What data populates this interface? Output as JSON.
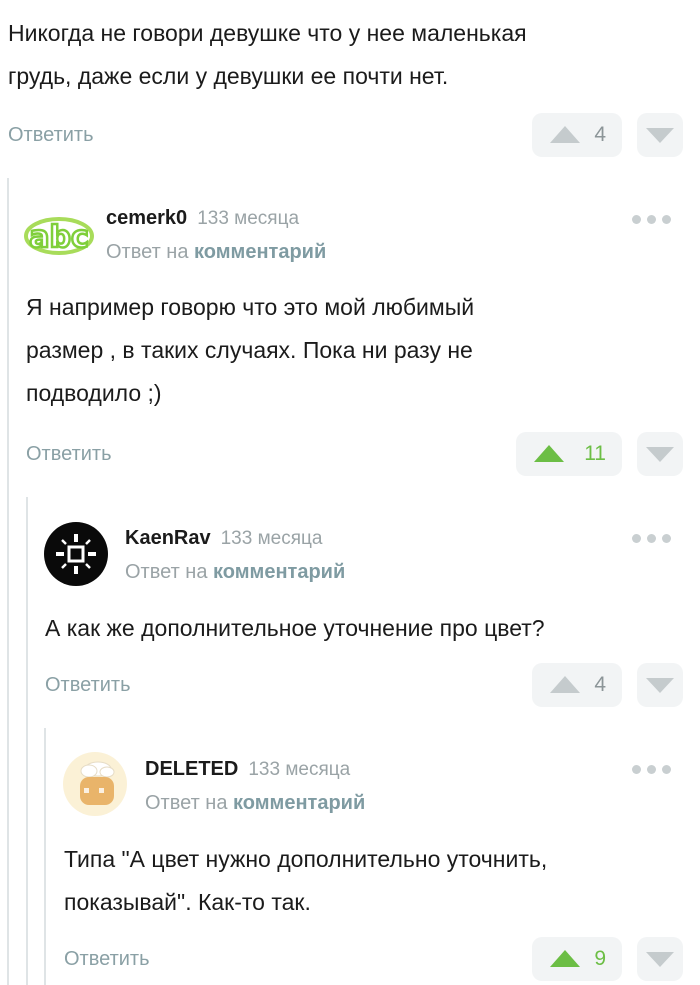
{
  "comments": [
    {
      "text_lines": [
        "Никогда не говори девушке что у нее маленькая",
        "грудь, даже если у девушки ее почти нет."
      ],
      "reply_label": "Ответить",
      "votes": "4",
      "votes_positive": false
    },
    {
      "author": "cemerk0",
      "time": "133 месяца",
      "reply_prefix": "Ответ на",
      "reply_link": "комментарий",
      "avatar": "abc-logo-icon",
      "text_lines": [
        "Я например говорю что это мой любимый",
        "размер , в таких случаях. Пока ни разу не",
        "подводило ;)"
      ],
      "reply_label": "Ответить",
      "votes": "11",
      "votes_positive": true
    },
    {
      "author": "KaenRav",
      "time": "133 месяца",
      "reply_prefix": "Ответ на",
      "reply_link": "комментарий",
      "avatar": "sun-symbol-icon",
      "text_lines": [
        "А как же дополнительное уточнение про цвет?"
      ],
      "reply_label": "Ответить",
      "votes": "4",
      "votes_positive": false
    },
    {
      "author": "DELETED",
      "time": "133 месяца",
      "reply_prefix": "Ответ на",
      "reply_link": "комментарий",
      "avatar": "toast-chef-icon",
      "text_lines": [
        "Типа \"А цвет нужно дополнительно уточнить,",
        "показывай\". Как-то так."
      ],
      "reply_label": "Ответить",
      "votes": "9",
      "votes_positive": true
    }
  ],
  "colors": {
    "upvote_positive": "#6cbe45",
    "reply_link": "#8aa0a5"
  }
}
